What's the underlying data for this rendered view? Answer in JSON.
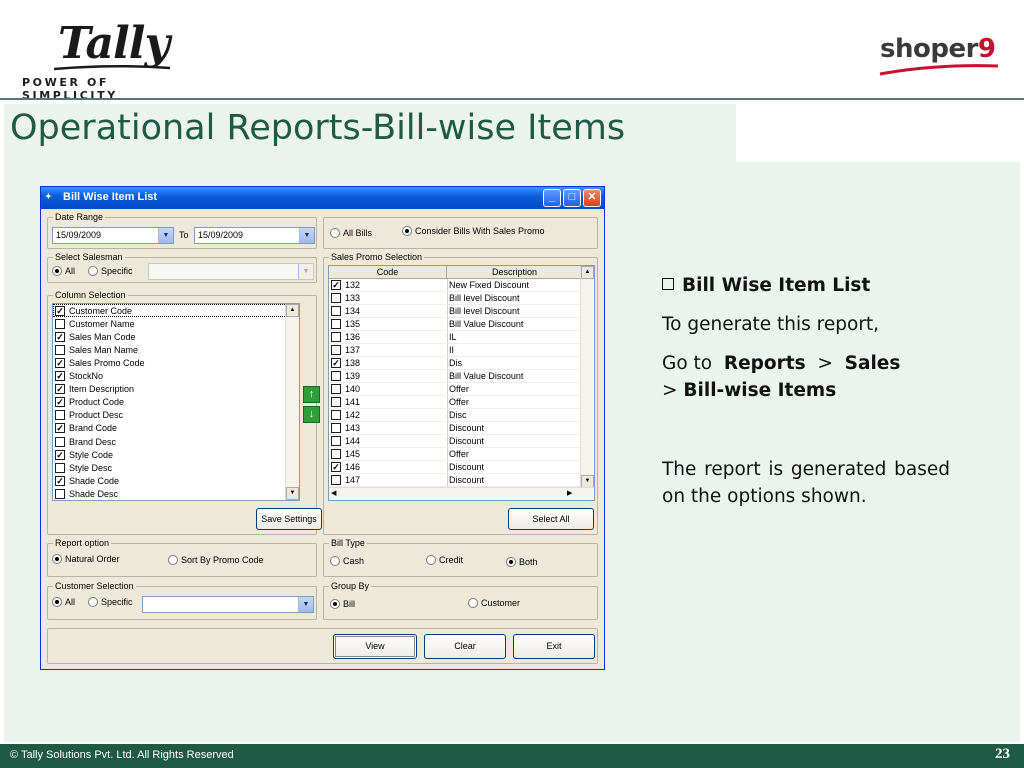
{
  "header": {
    "brand_word": "Tally",
    "brand_tagline": "POWER OF SIMPLICITY",
    "product_word": "shoper",
    "product_num": "9"
  },
  "page": {
    "title": "Operational Reports-Bill-wise Items"
  },
  "dialog": {
    "title": "Bill Wise Item List",
    "date_range": {
      "label": "Date Range",
      "from": "15/09/2009",
      "to_label": "To",
      "to": "15/09/2009"
    },
    "bills": {
      "all_label": "All Bills",
      "promo_label": "Consider Bills With Sales Promo"
    },
    "salesman": {
      "label": "Select Salesman",
      "all_label": "All",
      "specific_label": "Specific"
    },
    "columns": {
      "label": "Column Selection",
      "items": [
        {
          "label": "Customer Code",
          "checked": true
        },
        {
          "label": "Customer Name",
          "checked": false
        },
        {
          "label": "Sales Man Code",
          "checked": true
        },
        {
          "label": "Sales Man Name",
          "checked": false
        },
        {
          "label": "Sales Promo Code",
          "checked": true
        },
        {
          "label": "StockNo",
          "checked": true
        },
        {
          "label": "Item Description",
          "checked": true
        },
        {
          "label": "Product Code",
          "checked": true
        },
        {
          "label": "Product Desc",
          "checked": false
        },
        {
          "label": "Brand Code",
          "checked": true
        },
        {
          "label": "Brand Desc",
          "checked": false
        },
        {
          "label": "Style Code",
          "checked": true
        },
        {
          "label": "Style Desc",
          "checked": false
        },
        {
          "label": "Shade Code",
          "checked": true
        },
        {
          "label": "Shade Desc",
          "checked": false
        }
      ],
      "save_label": "Save Settings"
    },
    "promo": {
      "label": "Sales Promo Selection",
      "col_code": "Code",
      "col_desc": "Description",
      "rows": [
        {
          "code": "132",
          "desc": "New Fixed Discount",
          "checked": true
        },
        {
          "code": "133",
          "desc": "Bill level Discount",
          "checked": false
        },
        {
          "code": "134",
          "desc": "Bill level Discount",
          "checked": false
        },
        {
          "code": "135",
          "desc": "Bill Value Discount",
          "checked": false
        },
        {
          "code": "136",
          "desc": "IL",
          "checked": false
        },
        {
          "code": "137",
          "desc": "II",
          "checked": false
        },
        {
          "code": "138",
          "desc": "Dis",
          "checked": true
        },
        {
          "code": "139",
          "desc": "Bill Value Discount",
          "checked": false
        },
        {
          "code": "140",
          "desc": "Offer",
          "checked": false
        },
        {
          "code": "141",
          "desc": "Offer",
          "checked": false
        },
        {
          "code": "142",
          "desc": "Disc",
          "checked": false
        },
        {
          "code": "143",
          "desc": "Discount",
          "checked": false
        },
        {
          "code": "144",
          "desc": "Discount",
          "checked": false
        },
        {
          "code": "145",
          "desc": "Offer",
          "checked": false
        },
        {
          "code": "146",
          "desc": "Discount",
          "checked": true
        },
        {
          "code": "147",
          "desc": "Discount",
          "checked": false
        }
      ],
      "select_all_label": "Select All"
    },
    "report_option": {
      "label": "Report option",
      "natural_label": "Natural Order",
      "promo_sort_label": "Sort By Promo Code"
    },
    "bill_type": {
      "label": "Bill Type",
      "cash_label": "Cash",
      "credit_label": "Credit",
      "both_label": "Both"
    },
    "customer": {
      "label": "Customer Selection",
      "all_label": "All",
      "specific_label": "Specific"
    },
    "group_by": {
      "label": "Group By",
      "bill_label": "Bill",
      "customer_label": "Customer"
    },
    "actions": {
      "view_label": "View",
      "clear_label": "Clear",
      "exit_label": "Exit"
    }
  },
  "notes": {
    "heading": "Bill Wise Item List",
    "line1": "To generate this report,",
    "go_to": "Go to",
    "reports": "Reports",
    "sep1": ">",
    "sales": "Sales",
    "sep2": ">",
    "bill_wise_items": "Bill-wise Items",
    "paragraph": "The report is generated based on the options shown."
  },
  "footer": {
    "copyright": "© Tally Solutions Pvt. Ltd. All Rights Reserved",
    "page_number": "23"
  }
}
